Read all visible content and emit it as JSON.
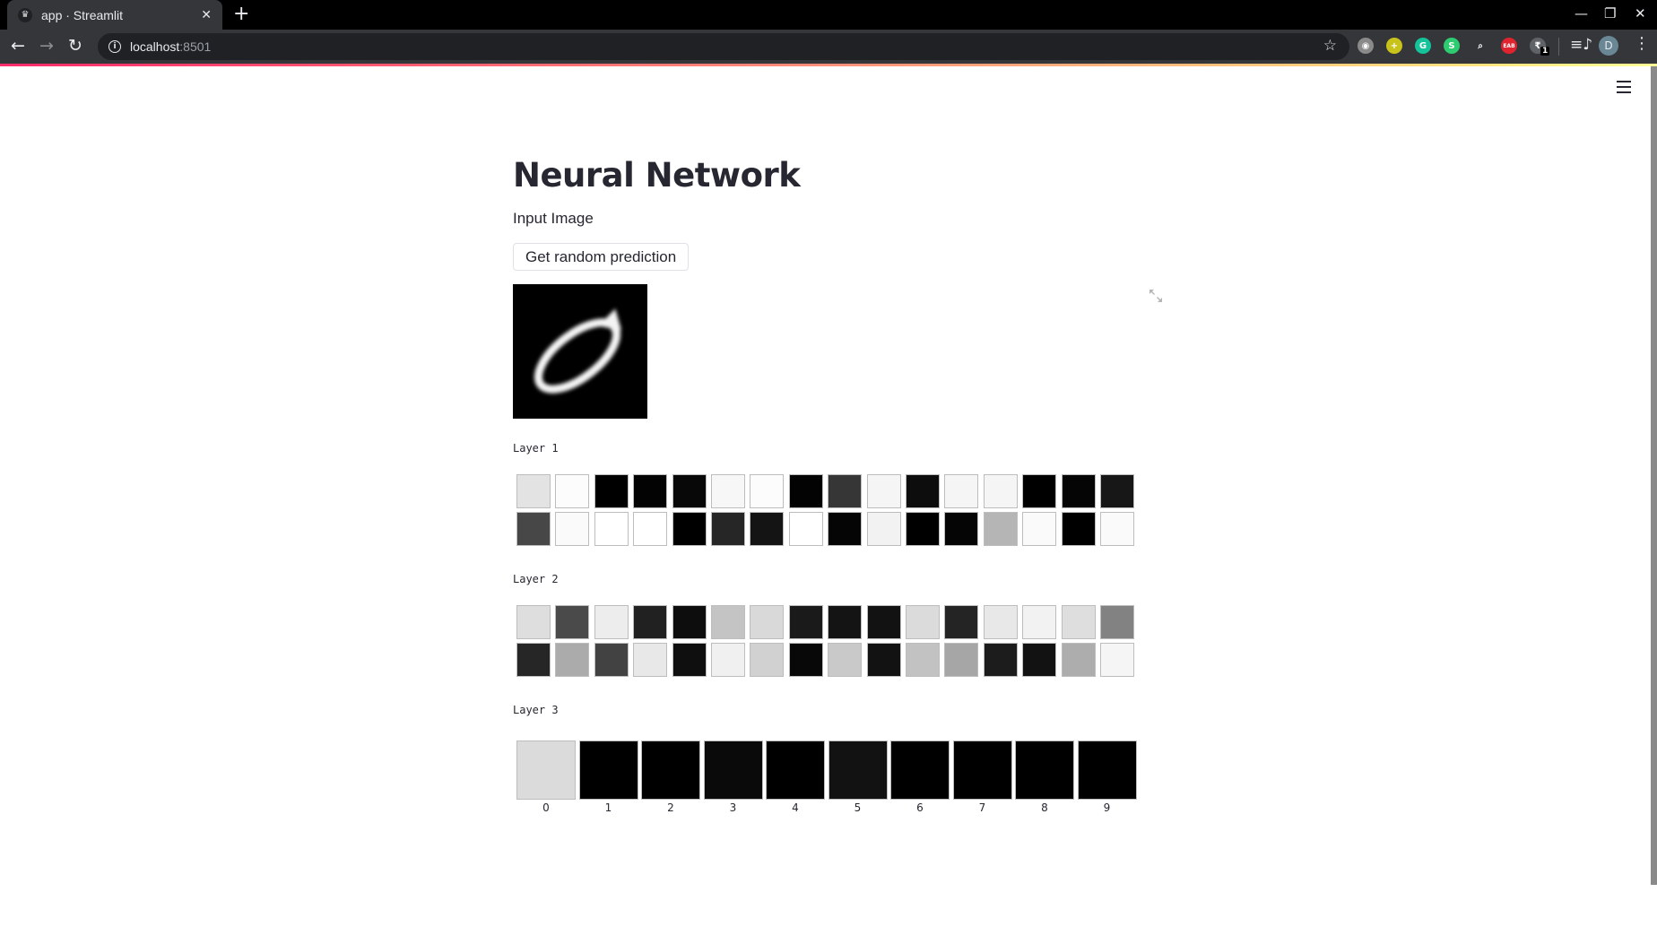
{
  "browser": {
    "tab_title": "app · Streamlit",
    "tab_favicon": "streamlit-crown-icon",
    "url_host": "localhost",
    "url_port": ":8501",
    "extensions": [
      {
        "name": "camera-extension-icon",
        "color": "#8a8a8a",
        "glyph": "◉"
      },
      {
        "name": "yellow-plus-extension-icon",
        "color": "#c8c31a",
        "glyph": "+"
      },
      {
        "name": "grammarly-extension-icon",
        "color": "#15c39a",
        "glyph": "G"
      },
      {
        "name": "s-extension-icon",
        "color": "#2ecc71",
        "glyph": "S"
      },
      {
        "name": "search-page-extension-icon",
        "color": "#35363a",
        "glyph": "⌕"
      },
      {
        "name": "eab-extension-icon",
        "color": "#e0242f",
        "glyph": "EAB"
      },
      {
        "name": "rupee-extension-icon",
        "color": "#5f6368",
        "glyph": "₹"
      }
    ],
    "extension_badge": "1",
    "profile_initial": "D"
  },
  "app": {
    "title": "Neural Network",
    "subtitle": "Input Image",
    "button_label": "Get random prediction",
    "input_image_alt": "handwritten digit 0"
  },
  "layers": [
    {
      "label": "Layer 1",
      "rows": [
        [
          0.89,
          0.99,
          0.0,
          0.01,
          0.03,
          0.97,
          0.99,
          0.01,
          0.21,
          0.96,
          0.05,
          0.96,
          0.96,
          0.0,
          0.02,
          0.09
        ],
        [
          0.28,
          0.98,
          1.0,
          1.0,
          0.0,
          0.15,
          0.08,
          1.0,
          0.02,
          0.95,
          0.0,
          0.02,
          0.71,
          0.98,
          0.0,
          0.98
        ]
      ]
    },
    {
      "label": "Layer 2",
      "rows": [
        [
          0.87,
          0.29,
          0.93,
          0.13,
          0.05,
          0.77,
          0.85,
          0.1,
          0.08,
          0.07,
          0.86,
          0.14,
          0.91,
          0.95,
          0.87,
          0.51
        ],
        [
          0.15,
          0.67,
          0.26,
          0.91,
          0.06,
          0.94,
          0.82,
          0.03,
          0.79,
          0.07,
          0.76,
          0.65,
          0.11,
          0.07,
          0.68,
          0.96
        ]
      ]
    }
  ],
  "output_layer": {
    "label": "Layer 3",
    "classes": [
      "0",
      "1",
      "2",
      "3",
      "4",
      "5",
      "6",
      "7",
      "8",
      "9"
    ],
    "activations": [
      0.86,
      0.0,
      0.0,
      0.04,
      0.0,
      0.07,
      0.0,
      0.0,
      0.0,
      0.0
    ]
  }
}
